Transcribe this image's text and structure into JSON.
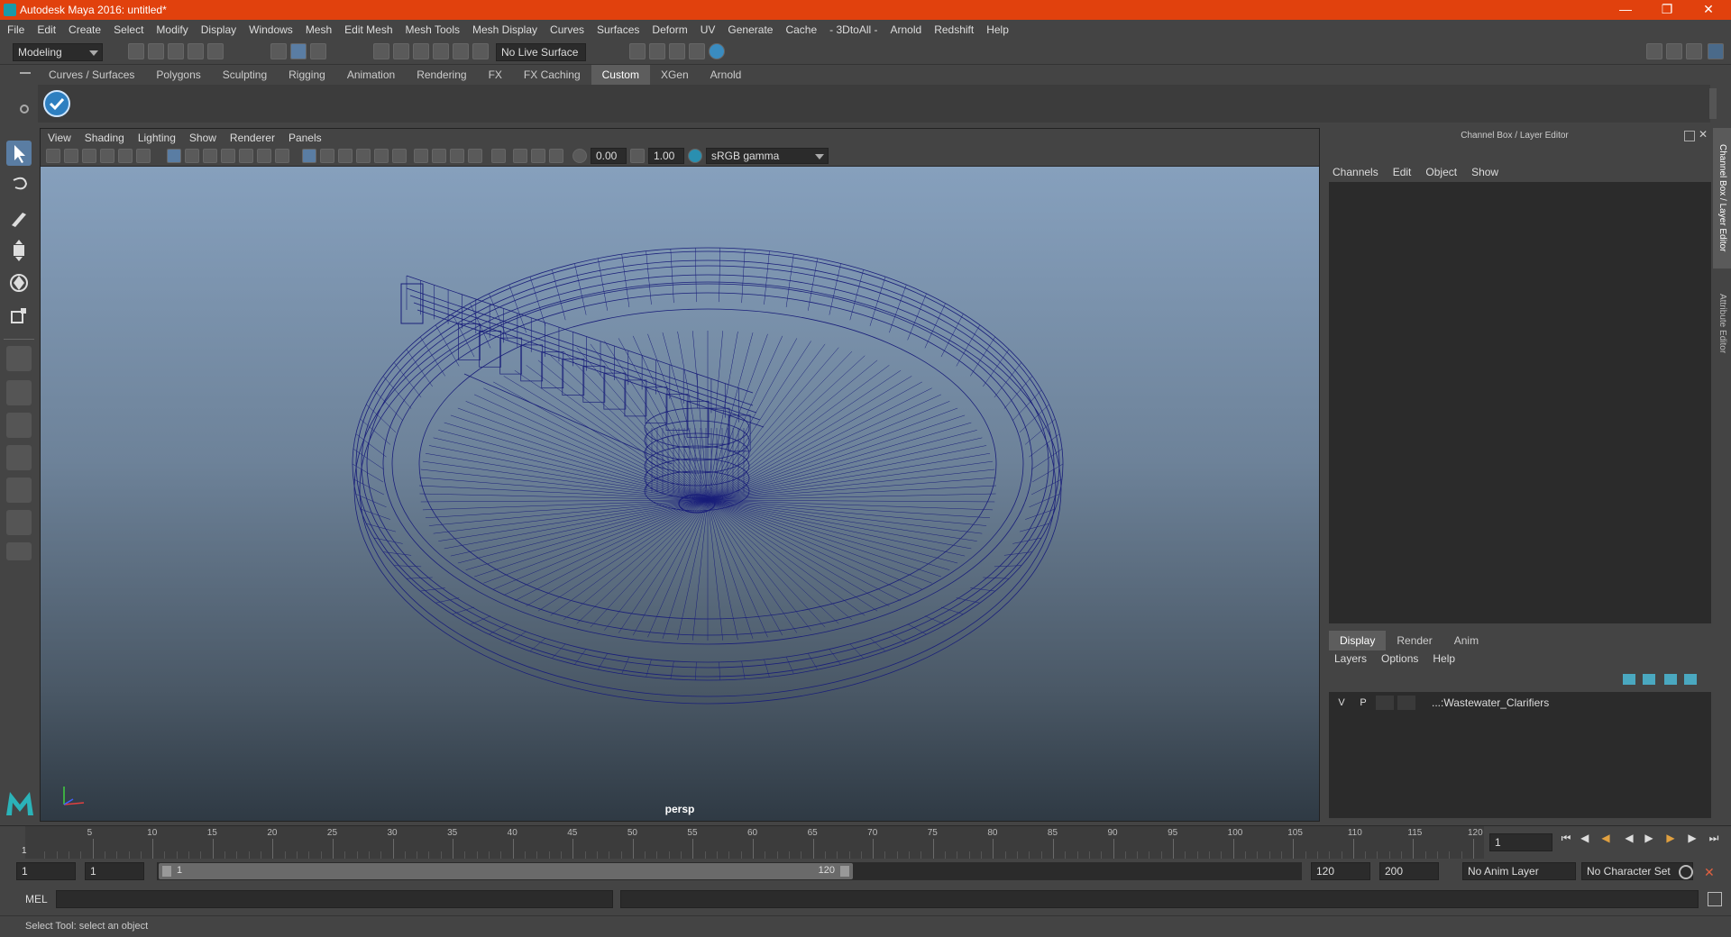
{
  "window": {
    "title": "Autodesk Maya 2016: untitled*"
  },
  "menu": [
    "File",
    "Edit",
    "Create",
    "Select",
    "Modify",
    "Display",
    "Windows",
    "Mesh",
    "Edit Mesh",
    "Mesh Tools",
    "Mesh Display",
    "Curves",
    "Surfaces",
    "Deform",
    "UV",
    "Generate",
    "Cache",
    "- 3DtoAll -",
    "Arnold",
    "Redshift",
    "Help"
  ],
  "status": {
    "mode": "Modeling",
    "live_surface": "No Live Surface"
  },
  "shelf": {
    "tabs": [
      "Curves / Surfaces",
      "Polygons",
      "Sculpting",
      "Rigging",
      "Animation",
      "Rendering",
      "FX",
      "FX Caching",
      "Custom",
      "XGen",
      "Arnold"
    ],
    "active": "Custom"
  },
  "viewport": {
    "menu": [
      "View",
      "Shading",
      "Lighting",
      "Show",
      "Renderer",
      "Panels"
    ],
    "exposure": "0.00",
    "gamma": "1.00",
    "colorspace": "sRGB gamma",
    "camera": "persp",
    "wire_color": "#1a1f7a"
  },
  "channelbox": {
    "title": "Channel Box / Layer Editor",
    "menu": [
      "Channels",
      "Edit",
      "Object",
      "Show"
    ],
    "side_tabs": [
      "Channel Box / Layer Editor",
      "Attribute Editor"
    ]
  },
  "layers": {
    "tabs": [
      "Display",
      "Render",
      "Anim"
    ],
    "active": "Display",
    "menu": [
      "Layers",
      "Options",
      "Help"
    ],
    "rows": [
      {
        "v": "V",
        "p": "P",
        "name": "...:Wastewater_Clarifiers"
      }
    ]
  },
  "timeline": {
    "ticks": [
      "5",
      "10",
      "15",
      "20",
      "25",
      "30",
      "35",
      "40",
      "45",
      "50",
      "55",
      "60",
      "65",
      "70",
      "75",
      "80",
      "85",
      "90",
      "95",
      "100",
      "105",
      "110",
      "115",
      "120"
    ],
    "current_frame": "1",
    "frame_start_marker": "1"
  },
  "range": {
    "start": "1",
    "playback_start": "1",
    "slider_start": "1",
    "slider_end": "120",
    "playback_end": "120",
    "end": "200",
    "anim_layer": "No Anim Layer",
    "character_set": "No Character Set"
  },
  "cmd": {
    "label": "MEL"
  },
  "help": {
    "text": "Select Tool: select an object"
  }
}
